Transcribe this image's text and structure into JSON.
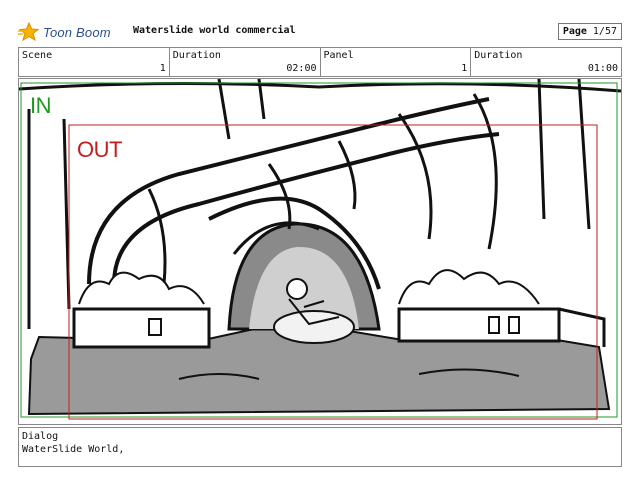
{
  "header": {
    "logo_text": "Toon Boom",
    "title": "Waterslide world commercial",
    "page_label": "Page",
    "page_value": "1/57"
  },
  "info": {
    "scene_label": "Scene",
    "scene_value": "1",
    "scene_duration_label": "Duration",
    "scene_duration_value": "02:00",
    "panel_label": "Panel",
    "panel_value": "1",
    "panel_duration_label": "Duration",
    "panel_duration_value": "01:00"
  },
  "panel": {
    "in_label": "IN",
    "out_label": "OUT",
    "in_color": "#1d9a24",
    "out_color": "#c51d1d"
  },
  "dialog": {
    "label": "Dialog",
    "text": "WaterSlide World,"
  }
}
